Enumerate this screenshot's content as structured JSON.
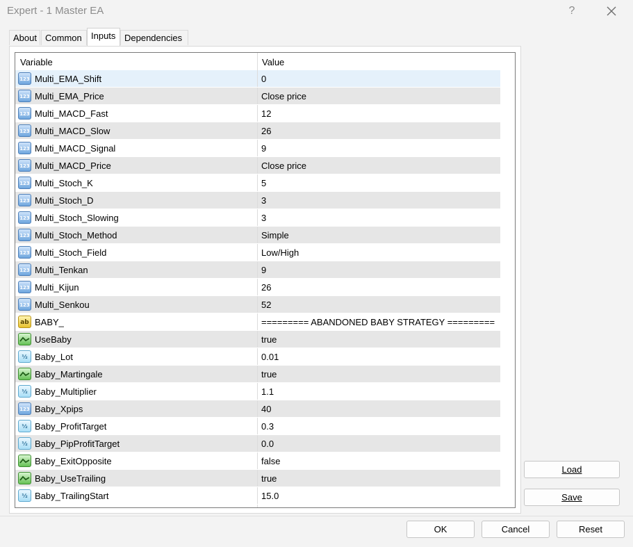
{
  "window": {
    "title": "Expert - 1 Master EA",
    "help_label": "?"
  },
  "tabs": [
    {
      "label": "About"
    },
    {
      "label": "Common"
    },
    {
      "label": "Inputs",
      "active": true
    },
    {
      "label": "Dependencies"
    }
  ],
  "grid": {
    "col_variable": "Variable",
    "col_value": "Value",
    "rows": [
      {
        "icon": "num",
        "name": "Multi_EMA_Shift",
        "value": "0"
      },
      {
        "icon": "num",
        "name": "Multi_EMA_Price",
        "value": "Close price"
      },
      {
        "icon": "num",
        "name": "Multi_MACD_Fast",
        "value": "12"
      },
      {
        "icon": "num",
        "name": "Multi_MACD_Slow",
        "value": "26"
      },
      {
        "icon": "num",
        "name": "Multi_MACD_Signal",
        "value": "9"
      },
      {
        "icon": "num",
        "name": "Multi_MACD_Price",
        "value": "Close price"
      },
      {
        "icon": "num",
        "name": "Multi_Stoch_K",
        "value": "5"
      },
      {
        "icon": "num",
        "name": "Multi_Stoch_D",
        "value": "3"
      },
      {
        "icon": "num",
        "name": "Multi_Stoch_Slowing",
        "value": "3"
      },
      {
        "icon": "num",
        "name": "Multi_Stoch_Method",
        "value": "Simple"
      },
      {
        "icon": "num",
        "name": "Multi_Stoch_Field",
        "value": "Low/High"
      },
      {
        "icon": "num",
        "name": "Multi_Tenkan",
        "value": "9"
      },
      {
        "icon": "num",
        "name": "Multi_Kijun",
        "value": "26"
      },
      {
        "icon": "num",
        "name": "Multi_Senkou",
        "value": "52"
      },
      {
        "icon": "str",
        "name": "BABY_",
        "value": "========= ABANDONED BABY STRATEGY ========="
      },
      {
        "icon": "bool",
        "name": "UseBaby",
        "value": "true"
      },
      {
        "icon": "dbl",
        "name": "Baby_Lot",
        "value": "0.01"
      },
      {
        "icon": "bool",
        "name": "Baby_Martingale",
        "value": "true"
      },
      {
        "icon": "dbl",
        "name": "Baby_Multiplier",
        "value": "1.1"
      },
      {
        "icon": "num",
        "name": "Baby_Xpips",
        "value": "40"
      },
      {
        "icon": "dbl",
        "name": "Baby_ProfitTarget",
        "value": "0.3"
      },
      {
        "icon": "dbl",
        "name": "Baby_PipProfitTarget",
        "value": "0.0"
      },
      {
        "icon": "bool",
        "name": "Baby_ExitOpposite",
        "value": "false"
      },
      {
        "icon": "bool",
        "name": "Baby_UseTrailing",
        "value": "true"
      },
      {
        "icon": "dbl",
        "name": "Baby_TrailingStart",
        "value": "15.0"
      }
    ]
  },
  "buttons": {
    "load": "Load",
    "save": "Save",
    "ok": "OK",
    "cancel": "Cancel",
    "reset": "Reset"
  },
  "icon_glyphs": {
    "num": "123",
    "str": "ab",
    "dbl": "½"
  }
}
